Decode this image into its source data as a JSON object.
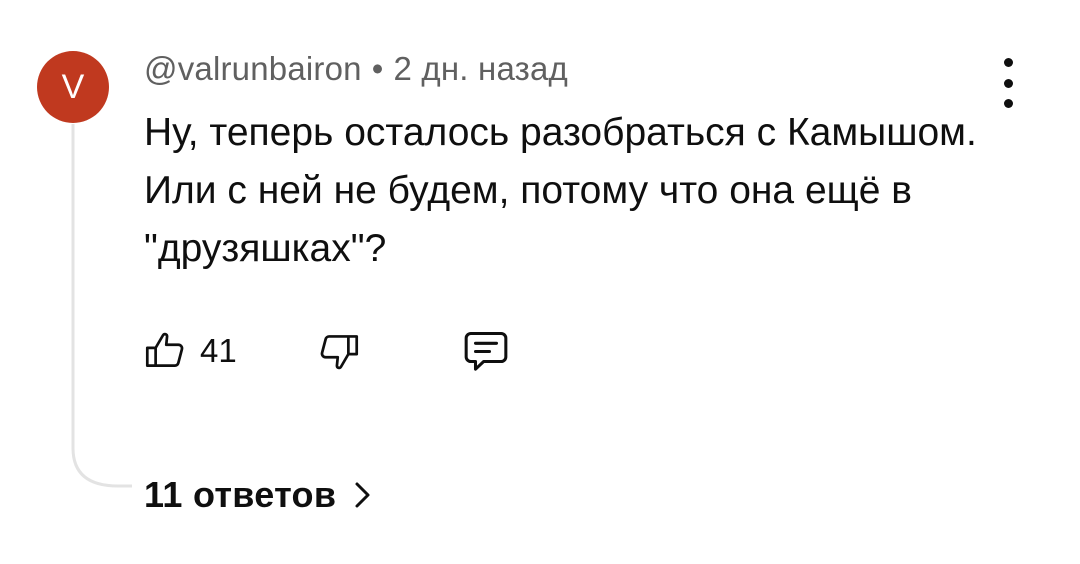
{
  "comment": {
    "avatar_letter": "V",
    "avatar_color": "#c0391f",
    "author": "@valrunbairon",
    "separator": "•",
    "time": "2 дн. назад",
    "text": "Ну, теперь осталось разобраться с Камышом. Или с ней не будем, потому что она ещё в \"друзяшках\"?",
    "menu_icon": "more-vertical-icon"
  },
  "actions": {
    "like_icon": "thumbs-up-icon",
    "like_count": "41",
    "dislike_icon": "thumbs-down-icon",
    "reply_icon": "comment-reply-icon"
  },
  "replies": {
    "label": "11 ответов",
    "icon": "chevron-right-icon"
  }
}
